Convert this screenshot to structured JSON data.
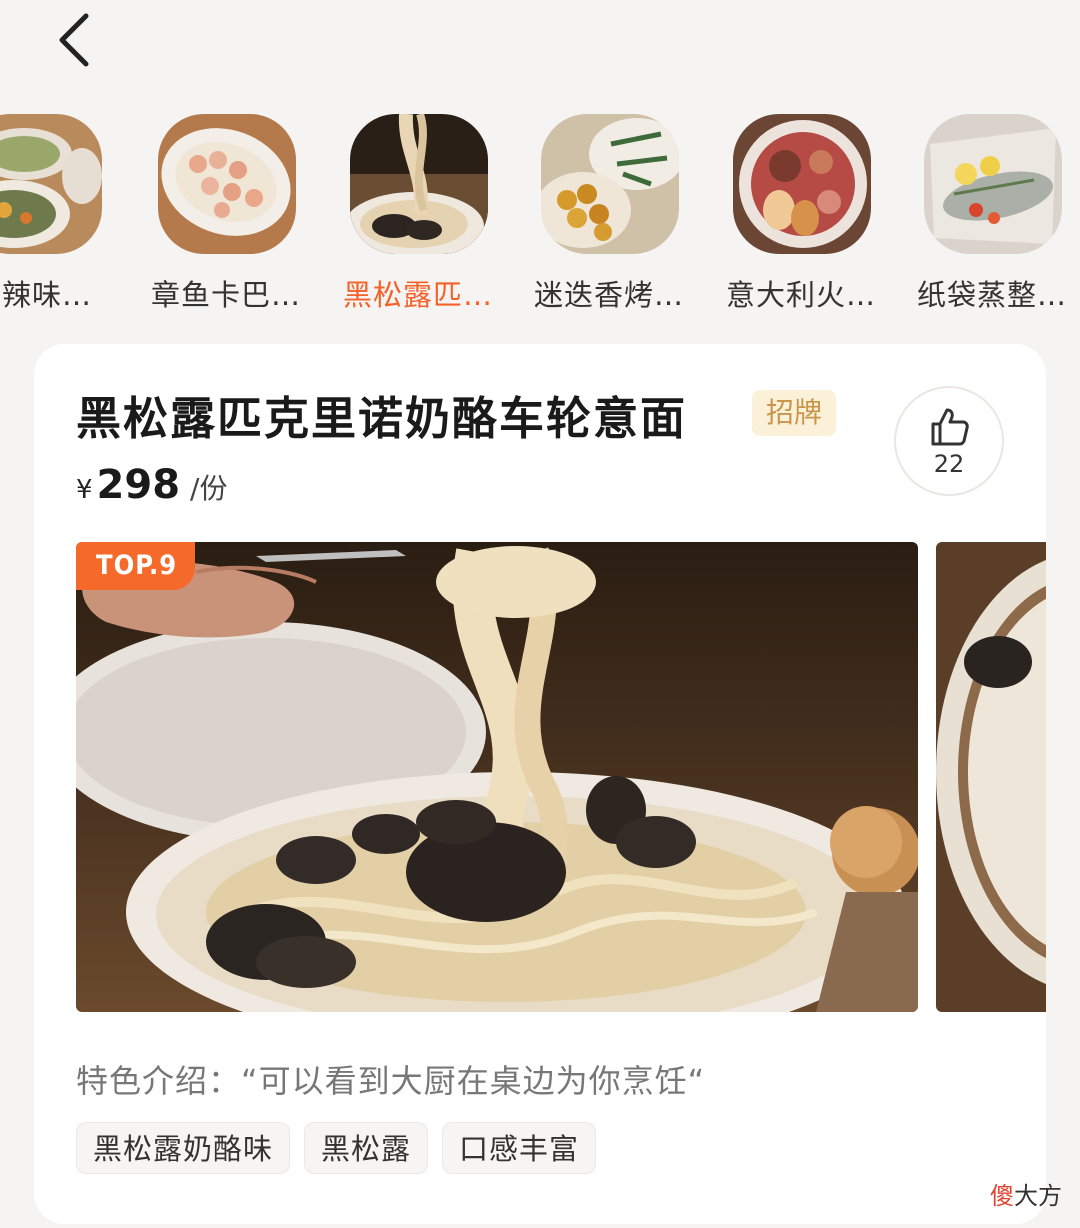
{
  "header": {
    "back_icon": "chevron-left-icon"
  },
  "dish_strip": {
    "items": [
      {
        "name": "利辣味…",
        "active": false
      },
      {
        "name": "章鱼卡巴…",
        "active": false
      },
      {
        "name": "黑松露匹…",
        "active": true
      },
      {
        "name": "迷迭香烤…",
        "active": false
      },
      {
        "name": "意大利火…",
        "active": false
      },
      {
        "name": "纸袋蒸整…",
        "active": false
      }
    ]
  },
  "card": {
    "title": "黑松露匹克里诺奶酪车轮意面",
    "badge": "招牌",
    "price": {
      "symbol": "¥",
      "value": "298",
      "unit": "/份"
    },
    "like": {
      "icon": "thumbs-up-icon",
      "count": "22"
    },
    "rank_badge": "TOP.9",
    "intro": "特色介绍：“可以看到大厨在桌边为你烹饪“",
    "tags": [
      "黑松露奶酪味",
      "黑松露",
      "口感丰富"
    ]
  },
  "watermark": {
    "accent": "傻",
    "rest": "大方"
  },
  "colors": {
    "accent": "#f4622a",
    "badge_bg": "#fbf0d8",
    "badge_text": "#c9954a",
    "background": "#f6f4f2"
  }
}
